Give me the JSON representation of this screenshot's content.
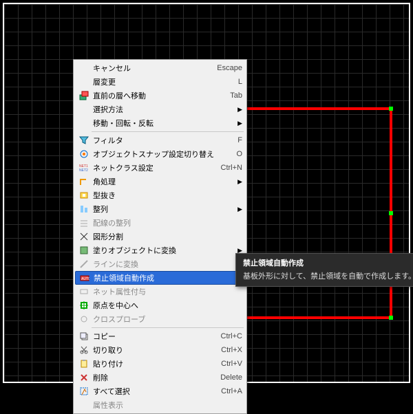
{
  "menu": {
    "items": [
      {
        "label": "キャンセル",
        "shortcut": "Escape",
        "icon": "",
        "enabled": true,
        "sub": false
      },
      {
        "label": "層変更",
        "shortcut": "L",
        "icon": "",
        "enabled": true,
        "sub": false
      },
      {
        "label": "直前の層へ移動",
        "shortcut": "Tab",
        "icon": "layer-icon",
        "enabled": true,
        "sub": false
      },
      {
        "label": "選択方法",
        "shortcut": "",
        "icon": "",
        "enabled": true,
        "sub": true
      },
      {
        "label": "移動・回転・反転",
        "shortcut": "",
        "icon": "",
        "enabled": true,
        "sub": true
      },
      {
        "sep": true
      },
      {
        "label": "フィルタ",
        "shortcut": "F",
        "icon": "funnel-icon",
        "enabled": true,
        "sub": false
      },
      {
        "label": "オブジェクトスナップ設定切り替え",
        "shortcut": "O",
        "icon": "snap-icon",
        "enabled": true,
        "sub": false
      },
      {
        "label": "ネットクラス設定",
        "shortcut": "Ctrl+N",
        "icon": "netclass-icon",
        "enabled": true,
        "sub": false
      },
      {
        "label": "角処理",
        "shortcut": "",
        "icon": "corner-icon",
        "enabled": true,
        "sub": true
      },
      {
        "label": "型抜き",
        "shortcut": "",
        "icon": "punch-icon",
        "enabled": true,
        "sub": false
      },
      {
        "label": "整列",
        "shortcut": "",
        "icon": "align-icon",
        "enabled": true,
        "sub": true
      },
      {
        "label": "配線の整列",
        "shortcut": "",
        "icon": "wirealign-icon",
        "enabled": false,
        "sub": false
      },
      {
        "label": "図形分割",
        "shortcut": "",
        "icon": "split-icon",
        "enabled": true,
        "sub": false
      },
      {
        "label": "塗りオブジェクトに変換",
        "shortcut": "",
        "icon": "fill-icon",
        "enabled": true,
        "sub": true
      },
      {
        "label": "ラインに変換",
        "shortcut": "",
        "icon": "toline-icon",
        "enabled": false,
        "sub": false
      },
      {
        "label": "禁止領域自動作成",
        "shortcut": "",
        "icon": "keepout-icon",
        "enabled": true,
        "sub": false,
        "selected": true
      },
      {
        "label": "ネット属性付与",
        "shortcut": "",
        "icon": "netattr-icon",
        "enabled": false,
        "sub": false
      },
      {
        "label": "原点を中心へ",
        "shortcut": "",
        "icon": "origin-icon",
        "enabled": true,
        "sub": false
      },
      {
        "label": "クロスプローブ",
        "shortcut": "",
        "icon": "probe-icon",
        "enabled": false,
        "sub": false
      },
      {
        "sep": true
      },
      {
        "label": "コピー",
        "shortcut": "Ctrl+C",
        "icon": "copy-icon",
        "enabled": true,
        "sub": false
      },
      {
        "label": "切り取り",
        "shortcut": "Ctrl+X",
        "icon": "cut-icon",
        "enabled": true,
        "sub": false
      },
      {
        "label": "貼り付け",
        "shortcut": "Ctrl+V",
        "icon": "paste-icon",
        "enabled": true,
        "sub": false
      },
      {
        "label": "削除",
        "shortcut": "Delete",
        "icon": "delete-icon",
        "enabled": true,
        "sub": false
      },
      {
        "label": "すべて選択",
        "shortcut": "Ctrl+A",
        "icon": "selectall-icon",
        "enabled": true,
        "sub": false
      },
      {
        "label": "属性表示",
        "shortcut": "",
        "icon": "",
        "enabled": false,
        "sub": false
      }
    ]
  },
  "tooltip": {
    "title": "禁止領域自動作成",
    "body": "基板外形に対して、禁止領域を自動で作成します。"
  }
}
